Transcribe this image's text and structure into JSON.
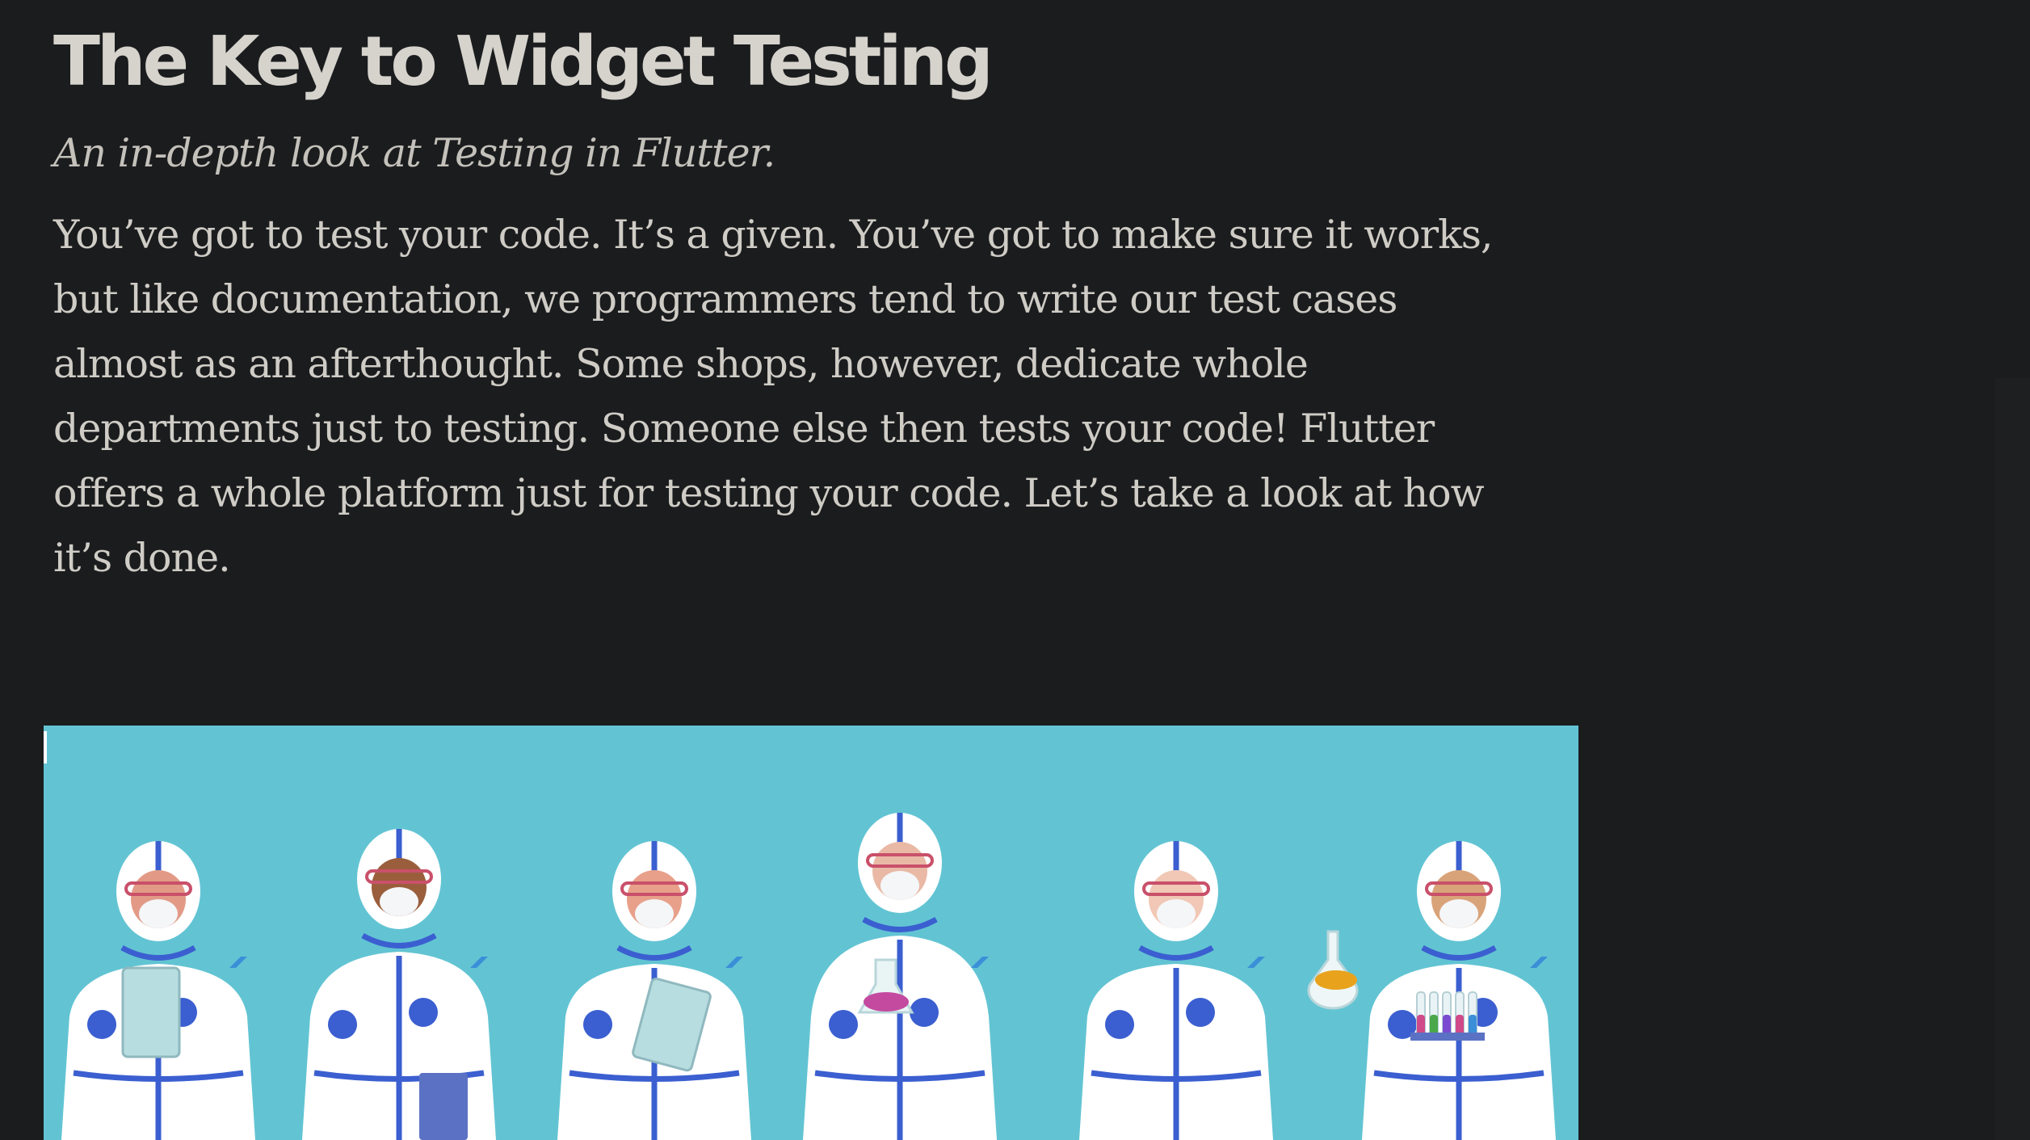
{
  "article": {
    "title": "The Key to Widget Testing",
    "subtitle": "An in-depth look at Testing in Flutter.",
    "paragraph_lines": [
      "You’ve got to test your code. It’s a given. You’ve got to make sure it works,",
      "but like documentation, we programmers tend to write our test cases",
      "almost as an afterthought. Some shops, however, dedicate whole",
      "departments just to testing. Someone else then tests your code! Flutter",
      "offers a whole platform just for testing your code. Let’s take a look at how",
      "it’s done."
    ]
  },
  "illustration": {
    "subject": "six lab workers in white protective suits with Flutter logos",
    "background_color": "#62c4d3",
    "suit_color": "#ffffff",
    "trim_color": "#3b5fd0"
  },
  "colors": {
    "page_background": "#1b1c1e",
    "title_text": "#d6d3cd",
    "body_text": "#cfccc6"
  }
}
